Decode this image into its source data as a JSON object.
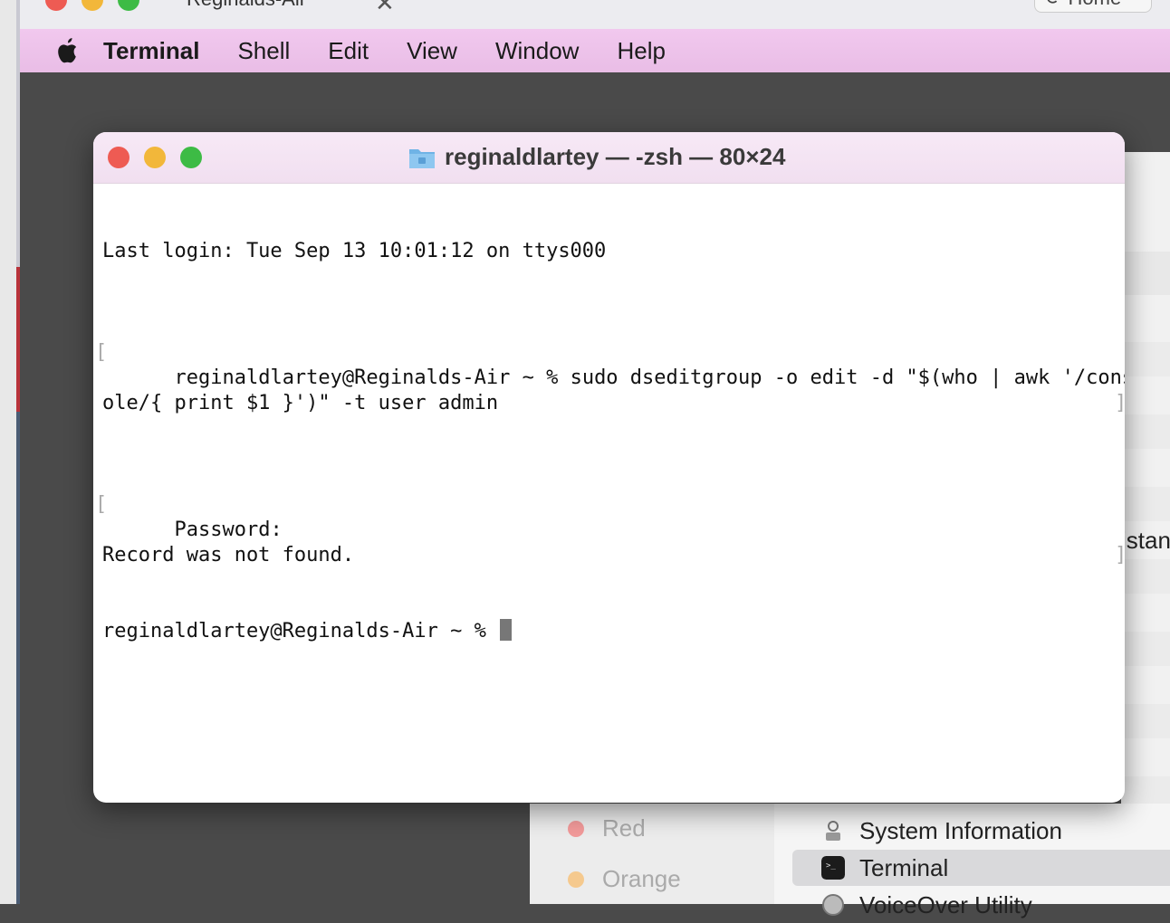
{
  "outer": {
    "title": "Reginalds-Air",
    "button_label": "Home"
  },
  "menubar": {
    "items": [
      "Terminal",
      "Shell",
      "Edit",
      "View",
      "Window",
      "Help"
    ]
  },
  "terminal": {
    "title": "reginaldlartey — -zsh — 80×24",
    "lines": [
      "Last login: Tue Sep 13 10:01:12 on ttys000",
      "reginaldlartey@Reginalds-Air ~ % sudo dseditgroup -o edit -d \"$(who | awk '/cons",
      "ole/{ print $1 }')\" -t user admin",
      "Password:",
      "Record was not found.",
      "reginaldlartey@Reginalds-Air ~ % "
    ]
  },
  "background": {
    "partial_text": "istan",
    "tags": [
      {
        "label": "Red",
        "color": "#f29a9a"
      },
      {
        "label": "Orange",
        "color": "#f5c98e"
      }
    ],
    "apps": [
      {
        "label": "System Information",
        "icon": "system-information-icon"
      },
      {
        "label": "Terminal",
        "icon": "terminal-icon"
      },
      {
        "label": "VoiceOver Utility",
        "icon": "voiceover-icon"
      }
    ]
  },
  "colors": {
    "menubar": "#edc3ea",
    "traffic_red": "#ee5b53",
    "traffic_yellow": "#f2b73a",
    "traffic_green": "#3dbb45"
  }
}
